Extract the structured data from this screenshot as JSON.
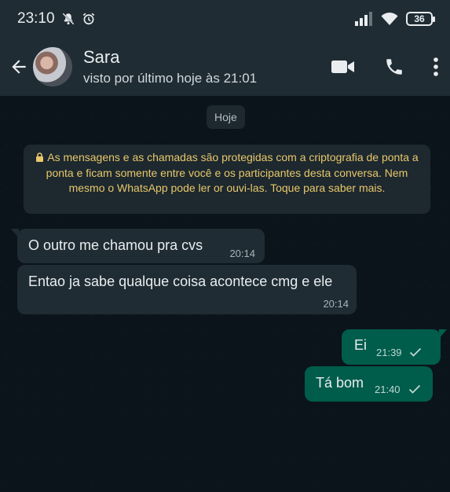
{
  "status_bar": {
    "time": "23:10",
    "battery": "36",
    "icons": [
      "mute-notifications-icon",
      "alarm-icon",
      "signal-icon",
      "wifi-icon",
      "battery-icon"
    ]
  },
  "header": {
    "contact_name": "Sara",
    "last_seen": "visto por último hoje às 21:01",
    "actions": [
      "video-call-icon",
      "voice-call-icon",
      "more-options-icon"
    ]
  },
  "chat": {
    "date_label": "Hoje",
    "encryption_notice": "As mensagens e as chamadas são protegidas com a criptografia de ponta a ponta e ficam somente entre você e os participantes desta conversa. Nem mesmo o WhatsApp pode ler or ouvi-las. Toque para saber mais.",
    "messages": [
      {
        "direction": "in",
        "text": "O outro me chamou pra cvs",
        "time": "20:14"
      },
      {
        "direction": "in",
        "text": "Entao ja sabe qualque coisa acontece cmg e ele",
        "time": "20:14"
      },
      {
        "direction": "out",
        "text": "Ei",
        "time": "21:39",
        "status": "sent"
      },
      {
        "direction": "out",
        "text": "Tá bom",
        "time": "21:40",
        "status": "sent"
      }
    ]
  },
  "colors": {
    "background": "#0b141a",
    "header": "#1f2c34",
    "incoming_bubble": "#1f2c34",
    "outgoing_bubble": "#005c4b",
    "encryption_text": "#e8c86a"
  }
}
